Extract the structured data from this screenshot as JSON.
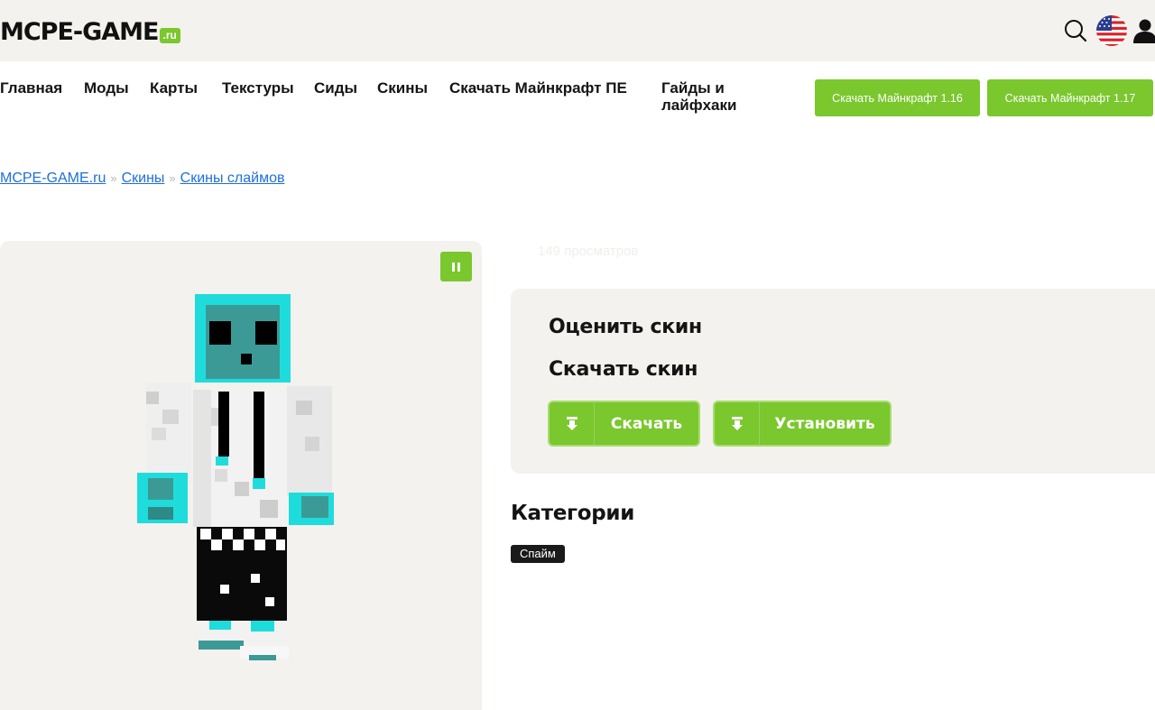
{
  "header": {
    "logo_text": "MCPE-GAME",
    "logo_suffix": ".ru"
  },
  "nav": {
    "items": [
      "Главная",
      "Моды",
      "Карты",
      "Текстуры",
      "Сиды",
      "Скины",
      "Скачать Майнкрафт ПЕ",
      "Гайды и лайфхаки"
    ],
    "buttons": [
      "Скачать Майнкрафт 1.16",
      "Скачать Майнкрафт 1.17"
    ]
  },
  "breadcrumb": {
    "items": [
      "MCPE-GAME.ru",
      "Скины",
      "Скины слаймов"
    ],
    "separator": "»"
  },
  "skin": {
    "views": "149 просматров"
  },
  "card": {
    "rate_title": "Оценить скин",
    "download_title": "Скачать скин",
    "download_label": "Скачать",
    "install_label": "Установить"
  },
  "categories": {
    "title": "Категории",
    "tags": [
      "Спайм"
    ]
  },
  "colors": {
    "accent": "#7ac72e",
    "link": "#1e6fd9",
    "panel": "#f4f2ee",
    "skin_cyan": "#1fdcdc",
    "skin_teal": "#3c9a96"
  },
  "icons": [
    "search-icon",
    "us-flag-icon",
    "user-icon",
    "pause-icon",
    "download-icon",
    "install-icon"
  ]
}
